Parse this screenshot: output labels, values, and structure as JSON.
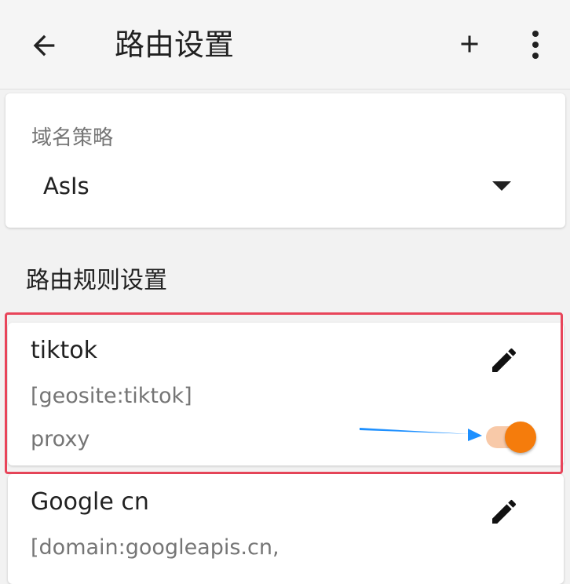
{
  "appbar": {
    "title": "路由设置",
    "icons": {
      "back": "arrow-back-icon",
      "add": "plus-icon",
      "more": "more-vert-icon"
    }
  },
  "domain_strategy": {
    "label": "域名策略",
    "selected": "AsIs"
  },
  "routing_rules": {
    "section_title": "路由规则设置",
    "rules": [
      {
        "name": "tiktok",
        "domain": "[geosite:tiktok]",
        "outbound": "proxy",
        "enabled": true
      },
      {
        "name": "Google cn",
        "domain": "[domain:googleapis.cn,"
      }
    ]
  },
  "colors": {
    "accent": "#f57c0c",
    "track": "#f8c9a8",
    "highlight_border": "#e8455a",
    "annotation_arrow": "#1e90ff"
  }
}
